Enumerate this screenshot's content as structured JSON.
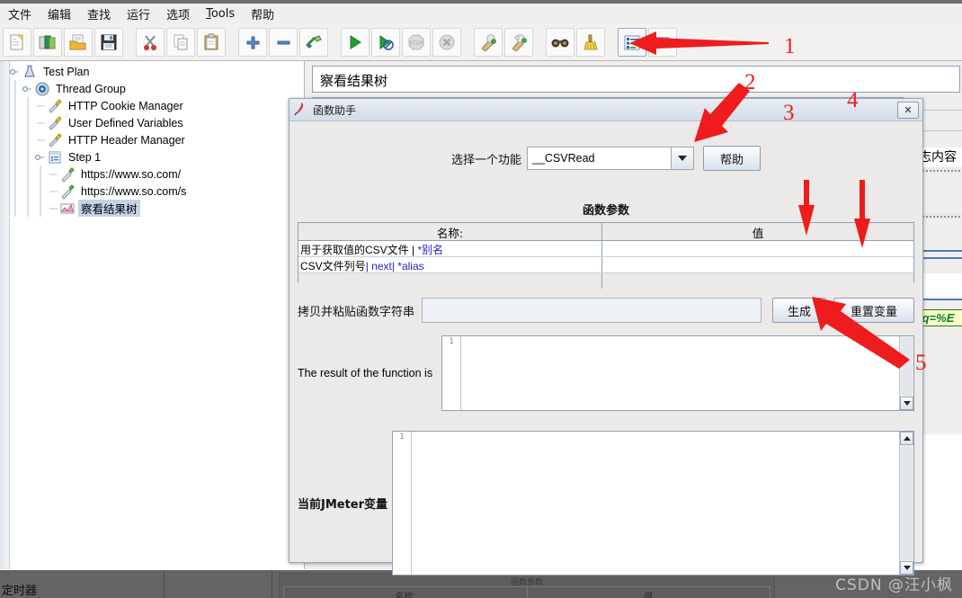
{
  "menu": {
    "items": [
      {
        "label": "文件"
      },
      {
        "label": "编辑"
      },
      {
        "label": "查找"
      },
      {
        "label": "运行"
      },
      {
        "label": "选项"
      },
      {
        "label": "Tools"
      },
      {
        "label": "帮助"
      }
    ]
  },
  "toolbar": {
    "buttons": [
      {
        "name": "new-icon",
        "title": "新建"
      },
      {
        "name": "templates-icon",
        "title": "模板"
      },
      {
        "name": "open-icon",
        "title": "打开"
      },
      {
        "name": "save-icon",
        "title": "保存"
      },
      {
        "name": "cut-icon",
        "title": "剪切"
      },
      {
        "name": "copy-icon",
        "title": "复制"
      },
      {
        "name": "paste-icon",
        "title": "粘贴"
      },
      {
        "name": "expand-icon",
        "title": "展开"
      },
      {
        "name": "collapse-icon",
        "title": "收起"
      },
      {
        "name": "toggle-icon",
        "title": "启用/禁用"
      },
      {
        "name": "start-icon",
        "title": "启动"
      },
      {
        "name": "start-no-pause-icon",
        "title": "无间隔启动"
      },
      {
        "name": "stop-icon",
        "title": "停止"
      },
      {
        "name": "shutdown-icon",
        "title": "关闭"
      },
      {
        "name": "clear-icon",
        "title": "清除"
      },
      {
        "name": "clear-all-icon",
        "title": "清除全部"
      },
      {
        "name": "search-icon",
        "title": "查找"
      },
      {
        "name": "reset-search-icon",
        "title": "重置查找"
      },
      {
        "name": "function-helper-icon",
        "title": "函数助手对话框"
      },
      {
        "name": "help-icon",
        "title": "帮助"
      }
    ]
  },
  "tree": {
    "nodes": [
      {
        "label": "Test Plan",
        "depth": 0,
        "icon": "test-plan-icon",
        "selected": false,
        "handle": true
      },
      {
        "label": "Thread Group",
        "depth": 1,
        "icon": "thread-group-icon",
        "selected": false,
        "handle": true
      },
      {
        "label": "HTTP Cookie Manager",
        "depth": 2,
        "icon": "config-icon",
        "selected": false,
        "handle": false
      },
      {
        "label": "User Defined Variables",
        "depth": 2,
        "icon": "config-icon",
        "selected": false,
        "handle": false
      },
      {
        "label": "HTTP Header Manager",
        "depth": 2,
        "icon": "config-icon",
        "selected": false,
        "handle": false
      },
      {
        "label": "Step 1",
        "depth": 2,
        "icon": "controller-icon",
        "selected": false,
        "handle": true
      },
      {
        "label": "https://www.so.com/",
        "depth": 3,
        "icon": "sampler-icon",
        "selected": false,
        "handle": false
      },
      {
        "label": "https://www.so.com/s",
        "depth": 3,
        "icon": "sampler-icon",
        "selected": false,
        "handle": false
      },
      {
        "label": "察看结果树",
        "depth": 3,
        "icon": "listener-icon",
        "selected": true,
        "handle": false
      }
    ]
  },
  "right_panel": {
    "title": "察看结果树",
    "log_label": "日志内容",
    "highlight_text": "e&q=%E"
  },
  "dialog": {
    "title": "函数助手",
    "title_icon": "jmeter-feather-icon",
    "close_label": "✕",
    "select_label": "选择一个功能",
    "selected_function": "__CSVRead",
    "help_button": "帮助",
    "params_title": "函数参数",
    "table": {
      "headers": [
        "名称:",
        "值"
      ],
      "rows": [
        {
          "name_plain": "用于获取值的CSV文件 | ",
          "name_blue": "*别名",
          "value": ""
        },
        {
          "name_plain": "CSV文件列号",
          "name_blue": "| next| *alias",
          "value": ""
        }
      ]
    },
    "copy_label": "拷贝并粘贴函数字符串",
    "copy_value": "",
    "generate_button": "生成",
    "reset_button": "重置变量",
    "result_label": "The result of the function is",
    "result_value": "",
    "result_line_number": "1",
    "vars_label": "当前JMeter变量",
    "vars_value": "",
    "vars_line_number": "1"
  },
  "bottom_window": {
    "label": "定时器",
    "panel_title": "函数参数",
    "table_headers": [
      "名称:",
      "值"
    ]
  },
  "watermark": "CSDN @汪小枫",
  "annotations": {
    "color": "#ee1c1c",
    "markers": [
      {
        "number": "1",
        "target": "function-helper-toolbar-button"
      },
      {
        "number": "2",
        "target": "function-select-dropdown"
      },
      {
        "number": "3",
        "target": "parameter-value-cell-row1"
      },
      {
        "number": "4",
        "target": "parameter-value-cell-row2"
      },
      {
        "number": "5",
        "target": "generate-button"
      }
    ]
  }
}
